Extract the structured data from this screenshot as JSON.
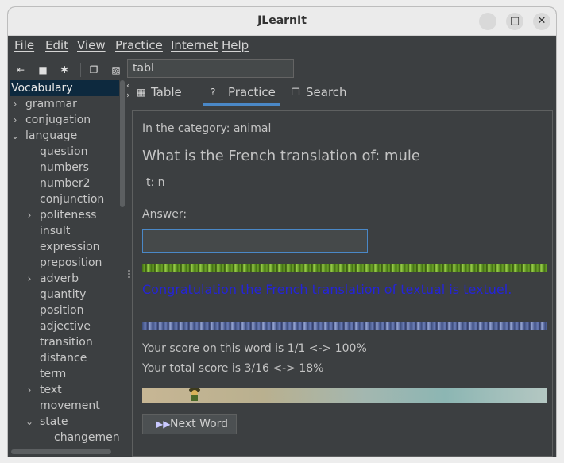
{
  "window": {
    "title": "JLearnIt"
  },
  "menu": [
    "File",
    "Edit",
    "View",
    "Practice",
    "Internet",
    "Help"
  ],
  "toolbar": {
    "search_value": "tabl"
  },
  "tree": {
    "root": "Vocabulary",
    "items": [
      {
        "label": "grammar"
      },
      {
        "label": "conjugation"
      },
      {
        "label": "language"
      },
      {
        "label": "question"
      },
      {
        "label": "numbers"
      },
      {
        "label": "number2"
      },
      {
        "label": "conjunction"
      },
      {
        "label": "politeness"
      },
      {
        "label": "insult"
      },
      {
        "label": "expression"
      },
      {
        "label": "preposition"
      },
      {
        "label": "adverb"
      },
      {
        "label": "quantity"
      },
      {
        "label": "position"
      },
      {
        "label": "adjective"
      },
      {
        "label": "transition"
      },
      {
        "label": "distance"
      },
      {
        "label": "term"
      },
      {
        "label": "text"
      },
      {
        "label": "movement"
      },
      {
        "label": "state"
      },
      {
        "label": "changement"
      }
    ]
  },
  "tabs": [
    "Table",
    "Practice",
    "Search"
  ],
  "practice": {
    "category": "In the category: animal",
    "question": "What is the French translation of: mule",
    "hint": "t: n",
    "answer_label": "Answer:",
    "answer_value": "",
    "feedback": "Congratulation the French translation of textual is textuel.",
    "word_score": "Your score on this word is 1/1 <-> 100%",
    "total_score": "Your total score is 3/16 <-> 18%",
    "next_button": "Next Word"
  }
}
